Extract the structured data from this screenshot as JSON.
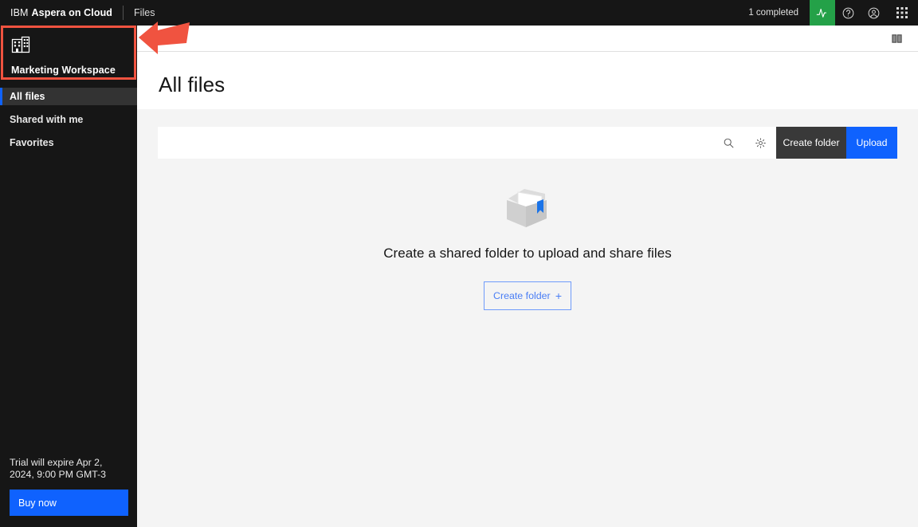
{
  "header": {
    "brand_ibm": "IBM",
    "brand_product": "Aspera on Cloud",
    "nav_files": "Files",
    "completed_status": "1 completed",
    "activity_icon": "activity-pulse-icon",
    "help_icon": "help-icon",
    "account_icon": "user-account-icon",
    "app_switcher_icon": "app-switcher-grid-icon",
    "background_color": "#161616"
  },
  "sidebar": {
    "workspace": {
      "icon": "building-workspace-icon",
      "name": "Marketing Workspace",
      "highlight_color": "#f05340"
    },
    "items": [
      {
        "label": "All files",
        "active": true
      },
      {
        "label": "Shared with me",
        "active": false
      },
      {
        "label": "Favorites",
        "active": false
      }
    ],
    "trial": {
      "message": "Trial will expire Apr 2, 2024, 9:00 PM GMT-3",
      "buy_label": "Buy now",
      "buy_color": "#0f62fe"
    },
    "active_indicator_color": "#0f62fe"
  },
  "main": {
    "panel_toggle_icon": "side-panel-toggle-icon",
    "page_title": "All files",
    "toolbar": {
      "search_icon": "search-icon",
      "settings_icon": "gear-icon",
      "create_folder_label": "Create folder",
      "upload_label": "Upload",
      "create_folder_color": "#393939",
      "upload_color": "#0f62fe"
    },
    "empty_state": {
      "illustration": "open-folder-illustration",
      "message": "Create a shared folder to upload and share files",
      "cta_label": "Create folder",
      "cta_plus": "+",
      "cta_color": "#4a7ef5"
    }
  },
  "annotation": {
    "arrow": "left-pointing-arrow",
    "color": "#f05340"
  }
}
